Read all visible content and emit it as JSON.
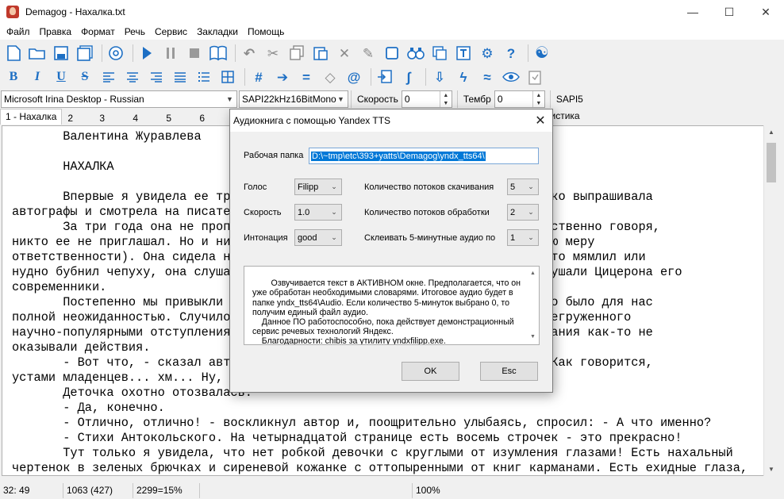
{
  "window": {
    "title": "Demagog - Нахалка.txt",
    "minimize": "—",
    "maximize": "☐",
    "close": "✕"
  },
  "menu": [
    "Файл",
    "Правка",
    "Формат",
    "Речь",
    "Сервис",
    "Закладки",
    "Помощь"
  ],
  "toolbar": {
    "row1": [
      "new-file-icon",
      "open-folder-icon",
      "save-icon",
      "save-all-icon",
      "disc-icon",
      "play-icon",
      "pause-icon",
      "stop-icon",
      "book-icon",
      "undo-icon",
      "cut-icon",
      "copy-icon",
      "paste-icon",
      "clear-icon",
      "edit-icon",
      "frame-icon",
      "binoculars-icon",
      "replace-icon",
      "text-icon",
      "gear-icon",
      "help-icon",
      "yin-yang-icon"
    ],
    "row2": [
      "bold-icon",
      "italic-icon",
      "underline-icon",
      "strike-icon",
      "align-left-icon",
      "align-center-icon",
      "align-right-icon",
      "justify-icon",
      "list-icon",
      "table-icon",
      "hash-icon",
      "arrow-right-icon",
      "equals-icon",
      "diamond-icon",
      "at-icon",
      "import-icon",
      "integral-icon",
      "down-arrow-icon",
      "lightning-icon",
      "approx-icon",
      "eye-icon",
      "clipboard-icon"
    ]
  },
  "voicebar": {
    "voice": "Microsoft Irina Desktop - Russian",
    "format": "SAPI22kHz16BitMono",
    "speed_label": "Скорость",
    "speed_value": "0",
    "timbre_label": "Тембр",
    "timbre_value": "0",
    "sapi": "SAPI5"
  },
  "tabs": [
    "1 - Нахалка",
    "2",
    "3",
    "4",
    "5",
    "6"
  ],
  "tab_stat": "тистика",
  "editor_text": "       Валентина Журавлева\n\n       НАХАЛКА\n\n       Впервые я увидела ее три                                    Она робко выпрашивала\nавтографы и смотрела на писател\n       За три года она не пропу                                тастов. Собственно говоря,\nникто ее не приглашал. Но и ник                                несем полную меру\nответственности). Она сидела на                                даже тех, кто мямлил или\nнудно бубнил чепуху, она слушал                                ероятно, слушали Цицерона его\nсовременники.\n       Постепенно мы привыкли к                                оворила, это было для нас\nполной неожиданностью. Случилос                                стого и перегруженного\nнаучно-популярными отступлениям                                еские замечания как-то не\nоказывали действия.\n       - Вот что, - сказал авто                                т ребенку. Как говорится,\nустами младенцев... хм... Ну, д                                ниге?\n       Деточка охотно отозвалась.\n       - Да, конечно.\n       - Отлично, отлично! - воскликнул автор и, поощрительно улыбаясь, спросил: - А что именно?\n       - Стихи Антокольского. На четырнадцатой странице есть восемь строчек - это прекрасно!\n       Тут только я увидела, что нет робкой девочки с круглыми от изумления глазами! Есть нахальный\nчертенок в зеленых брючках и сиреневой кожанке с оттопыренными от книг карманами. Есть ехидные глаза,",
  "status": [
    "32: 49",
    "1063 (427)",
    "2299=15%",
    "",
    "100%"
  ],
  "dialog": {
    "title": "Аудиокнига с помощью Yandex TTS",
    "folder_label": "Рабочая папка",
    "folder_value": "D:\\~tmp\\etc\\393+yatts\\Demagog\\yndx_tts64\\",
    "voice_label": "Голос",
    "voice_value": "Filipp",
    "speed_label": "Скорость",
    "speed_value": "1.0",
    "intonation_label": "Интонация",
    "intonation_value": "good",
    "download_threads_label": "Количество потоков скачивания",
    "download_threads_value": "5",
    "process_threads_label": "Количество потоков обработки",
    "process_threads_value": "2",
    "merge_label": "Склеивать 5-минутные аудио по",
    "merge_value": "1",
    "info_text": "    Озвучивается текст в АКТИВНОМ окне. Предполагается, что он\nуже обработан необходимыми словарями. Итоговое аудио будет в\nпапке yndx_tts64\\Audio. Если количество 5-минуток выбрано 0, то\nполучим единый файл аудио.\n    Данное ПО работоспособно, пока действует демонстрационный\nсервис речевых технологий Яндекс.\n    Благодарности: chibis за утилиту yndxfilipp.exe.",
    "ok": "OK",
    "esc": "Esc"
  }
}
